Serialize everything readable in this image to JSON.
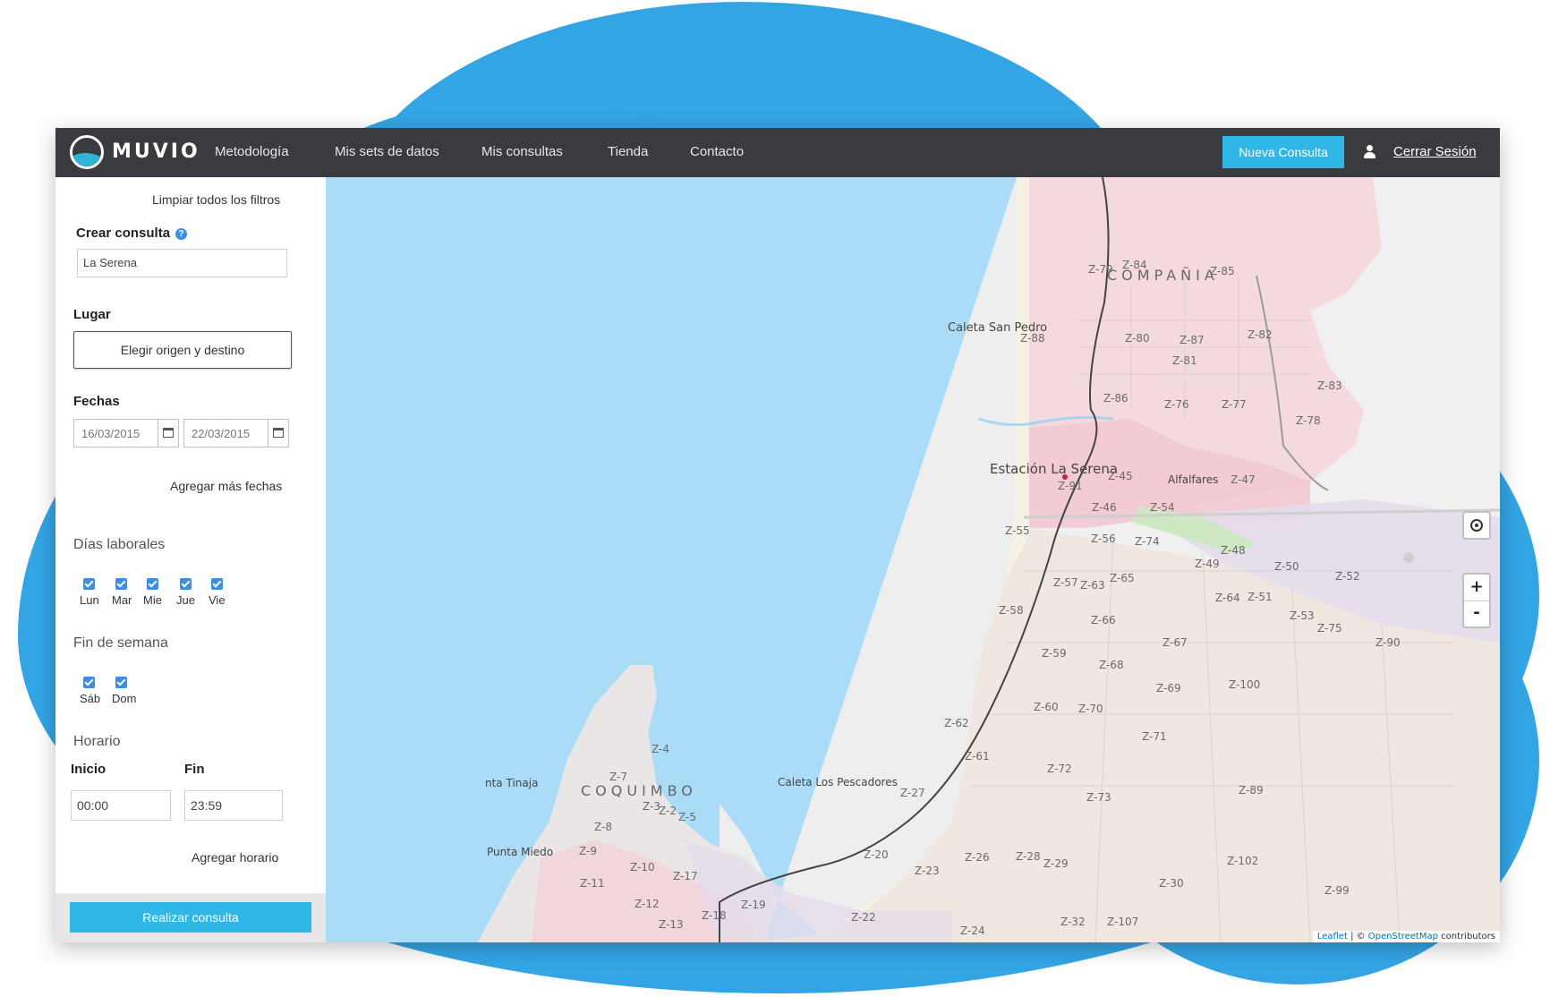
{
  "app": {
    "brand": "MUVIO"
  },
  "nav": {
    "items": [
      "Metodología",
      "Mis sets de datos",
      "Mis consultas",
      "Tienda",
      "Contacto"
    ],
    "new_query_button": "Nueva Consulta",
    "logout": "Cerrar Sesión"
  },
  "sidebar": {
    "clear_filters": "Limpiar todos los filtros",
    "create_query_label": "Crear consulta",
    "help_glyph": "?",
    "query_name_value": "La Serena",
    "place_label": "Lugar",
    "choose_od_button": "Elegir origen y destino",
    "dates_label": "Fechas",
    "date_start": "16/03/2015",
    "date_end": "22/03/2015",
    "add_dates": "Agregar más fechas",
    "weekdays_label": "Días laborales",
    "weekdays": [
      {
        "label": "Lun",
        "checked": true
      },
      {
        "label": "Mar",
        "checked": true
      },
      {
        "label": "Mie",
        "checked": true
      },
      {
        "label": "Jue",
        "checked": true
      },
      {
        "label": "Vie",
        "checked": true
      }
    ],
    "weekend_label": "Fin de semana",
    "weekend": [
      {
        "label": "Sáb",
        "checked": true
      },
      {
        "label": "Dom",
        "checked": true
      }
    ],
    "schedule_label": "Horario",
    "start_label": "Inicio",
    "end_label": "Fin",
    "start_value": "00:00",
    "end_value": "23:59",
    "add_schedule": "Agregar horario",
    "submit_button": "Realizar consulta"
  },
  "map": {
    "cities": [
      "COMPAÑIA",
      "COQUIMBO"
    ],
    "places": [
      "Caleta San Pedro",
      "Estación La Serena",
      "Alfalfares",
      "Caleta Los Pescadores",
      "nta Tinaja",
      "Punta Miedo"
    ],
    "zones": [
      "Z-79",
      "Z-84",
      "Z-85",
      "Z-88",
      "Z-80",
      "Z-87",
      "Z-82",
      "Z-81",
      "Z-83",
      "Z-86",
      "Z-76",
      "Z-77",
      "Z-78",
      "Z-45",
      "Z-47",
      "Z-91",
      "Z-46",
      "Z-54",
      "Z-55",
      "Z-56",
      "Z-74",
      "Z-48",
      "Z-49",
      "Z-50",
      "Z-52",
      "Z-57",
      "Z-63",
      "Z-65",
      "Z-64",
      "Z-51",
      "Z-58",
      "Z-53",
      "Z-75",
      "Z-66",
      "Z-67",
      "Z-90",
      "Z-59",
      "Z-68",
      "Z-100",
      "Z-69",
      "Z-62",
      "Z-60",
      "Z-70",
      "Z-71",
      "Z-61",
      "Z-72",
      "Z-4",
      "Z-7",
      "Z-27",
      "Z-73",
      "Z-89",
      "Z-3",
      "Z-2",
      "Z-5",
      "Z-8",
      "Z-9",
      "Z-10",
      "Z-17",
      "Z-20",
      "Z-26",
      "Z-28",
      "Z-29",
      "Z-102",
      "Z-23",
      "Z-11",
      "Z-30",
      "Z-12",
      "Z-19",
      "Z-99",
      "Z-18",
      "Z-13",
      "Z-22",
      "Z-32",
      "Z-107",
      "Z-24"
    ],
    "zoom_in": "+",
    "zoom_out": "-",
    "attribution_leaflet": "Leaflet",
    "attribution_sep": " | © ",
    "attribution_osm": "OpenStreetMap",
    "attribution_tail": " contributors"
  },
  "colors": {
    "nav_bg": "#3a3b3e",
    "accent": "#2fb7e8",
    "sea": "#aadcf7",
    "blob": "#33a5e5",
    "checkbox": "#3a8ee6"
  }
}
